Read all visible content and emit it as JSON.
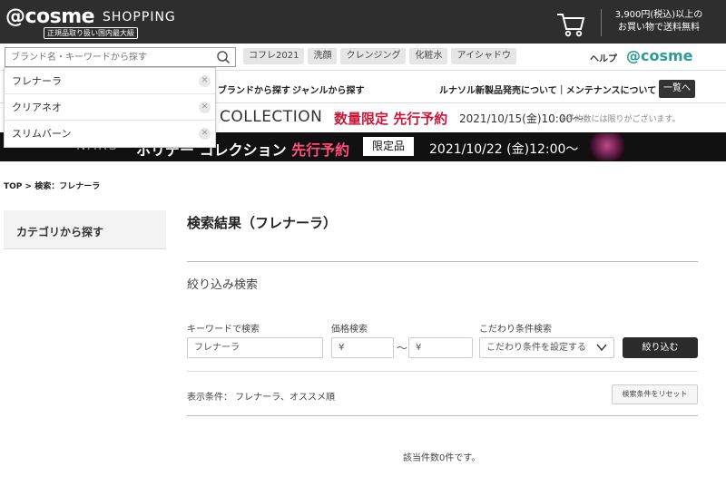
{
  "header": {
    "logo": "@cosme",
    "logo_sub": "SHOPPING",
    "logo_badge": "正規品取り扱い国内最大級",
    "shipping_line1": "3,900円(税込)以上の",
    "shipping_line2": "お買い物で送料無料"
  },
  "search": {
    "placeholder": "ブランド名・キーワードから探す",
    "tags": [
      "コフレ2021",
      "洗顔",
      "クレンジング",
      "化粧水",
      "アイシャドウ"
    ],
    "help": "ヘルプ",
    "atcosme_link": "@cosme",
    "suggestions": [
      "フレナーラ",
      "クリアネオ",
      "スリムバーン"
    ]
  },
  "nav": {
    "brand": "ブランドから探す",
    "genre": "ジャンルから探す",
    "maint": "ルナソル新製品発売について｜メンテナンスについて",
    "list_btn": "一覧へ"
  },
  "banner1": {
    "title": "COLLECTION",
    "red": "数量限定 先行予約",
    "date": "2021/10/15(金)10:00〜",
    "note": "※予約数には限りがございます。"
  },
  "banner2": {
    "brand": "NARS",
    "title_a": "ホリデー コレクション ",
    "title_b": "先行予約",
    "badge": "限定品",
    "date": "2021/10/22 (金)12:00〜"
  },
  "breadcrumb": "TOP > 検索：フレナーラ",
  "sidebar": {
    "category": "カテゴリから探す"
  },
  "main": {
    "result_title": "検索結果（フレナーラ）",
    "refine_title": "絞り込み検索",
    "keyword_label": "キーワードで検索",
    "keyword_value": "フレナーラ",
    "price_label": "価格検索",
    "price_min": "¥",
    "price_tilde": "〜",
    "price_max": "¥",
    "condition_label": "こだわり条件検索",
    "condition_value": "こだわり条件を設定する",
    "submit": "絞り込む",
    "conditions_text": "表示条件： フレナーラ、オススメ順",
    "reset": "検索条件をリセット",
    "empty": "該当件数0件です。"
  },
  "colors": {
    "header_bg": "#2e2e2e",
    "accent_red": "#c8173a",
    "accent_teal": "#2a9b8e"
  }
}
